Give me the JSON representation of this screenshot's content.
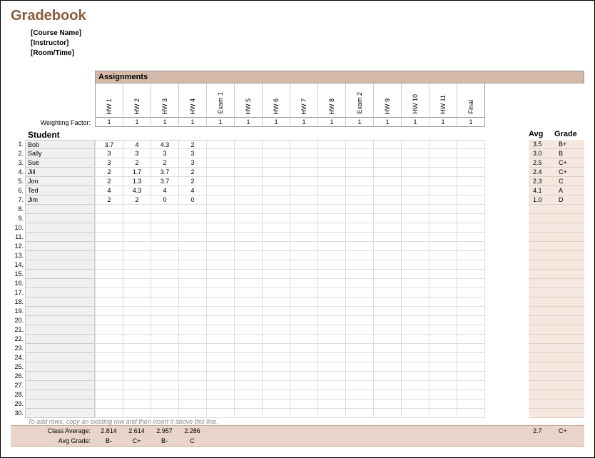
{
  "title": "Gradebook",
  "meta": {
    "course": "[Course Name]",
    "instructor": "[Instructor]",
    "room": "[Room/Time]"
  },
  "assignments_label": "Assignments",
  "assignments": [
    "HW 1",
    "HW 2",
    "HW 3",
    "HW 4",
    "Exam 1",
    "HW 5",
    "HW 6",
    "HW 7",
    "HW 8",
    "Exam 2",
    "HW 9",
    "HW 10",
    "HW 11",
    "Final"
  ],
  "weighting_label": "Weighting Factor:",
  "weights": [
    "1",
    "1",
    "1",
    "1",
    "1",
    "1",
    "1",
    "1",
    "1",
    "1",
    "1",
    "1",
    "1",
    "1"
  ],
  "student_header": "Student",
  "avg_header": "Avg",
  "grade_header": "Grade",
  "students": [
    {
      "num": "1.",
      "name": "Bob",
      "scores": [
        "3.7",
        "4",
        "4.3",
        "2",
        "",
        "",
        "",
        "",
        "",
        "",
        "",
        "",
        "",
        ""
      ],
      "avg": "3.5",
      "grade": "B+"
    },
    {
      "num": "2.",
      "name": "Sally",
      "scores": [
        "3",
        "3",
        "3",
        "3",
        "",
        "",
        "",
        "",
        "",
        "",
        "",
        "",
        "",
        ""
      ],
      "avg": "3.0",
      "grade": "B"
    },
    {
      "num": "3.",
      "name": "Sue",
      "scores": [
        "3",
        "2",
        "2",
        "3",
        "",
        "",
        "",
        "",
        "",
        "",
        "",
        "",
        "",
        ""
      ],
      "avg": "2.5",
      "grade": "C+"
    },
    {
      "num": "4.",
      "name": "Jill",
      "scores": [
        "2",
        "1.7",
        "3.7",
        "2",
        "",
        "",
        "",
        "",
        "",
        "",
        "",
        "",
        "",
        ""
      ],
      "avg": "2.4",
      "grade": "C+"
    },
    {
      "num": "5.",
      "name": "Jon",
      "scores": [
        "2",
        "1.3",
        "3.7",
        "2",
        "",
        "",
        "",
        "",
        "",
        "",
        "",
        "",
        "",
        ""
      ],
      "avg": "2.3",
      "grade": "C"
    },
    {
      "num": "6.",
      "name": "Ted",
      "scores": [
        "4",
        "4.3",
        "4",
        "4",
        "",
        "",
        "",
        "",
        "",
        "",
        "",
        "",
        "",
        ""
      ],
      "avg": "4.1",
      "grade": "A"
    },
    {
      "num": "7.",
      "name": "Jim",
      "scores": [
        "2",
        "2",
        "0",
        "0",
        "",
        "",
        "",
        "",
        "",
        "",
        "",
        "",
        "",
        ""
      ],
      "avg": "1.0",
      "grade": "D"
    },
    {
      "num": "8.",
      "name": "",
      "scores": [
        "",
        "",
        "",
        "",
        "",
        "",
        "",
        "",
        "",
        "",
        "",
        "",
        "",
        ""
      ],
      "avg": "",
      "grade": ""
    },
    {
      "num": "9.",
      "name": "",
      "scores": [
        "",
        "",
        "",
        "",
        "",
        "",
        "",
        "",
        "",
        "",
        "",
        "",
        "",
        ""
      ],
      "avg": "",
      "grade": ""
    },
    {
      "num": "10.",
      "name": "",
      "scores": [
        "",
        "",
        "",
        "",
        "",
        "",
        "",
        "",
        "",
        "",
        "",
        "",
        "",
        ""
      ],
      "avg": "",
      "grade": ""
    },
    {
      "num": "11.",
      "name": "",
      "scores": [
        "",
        "",
        "",
        "",
        "",
        "",
        "",
        "",
        "",
        "",
        "",
        "",
        "",
        ""
      ],
      "avg": "",
      "grade": ""
    },
    {
      "num": "12.",
      "name": "",
      "scores": [
        "",
        "",
        "",
        "",
        "",
        "",
        "",
        "",
        "",
        "",
        "",
        "",
        "",
        ""
      ],
      "avg": "",
      "grade": ""
    },
    {
      "num": "13.",
      "name": "",
      "scores": [
        "",
        "",
        "",
        "",
        "",
        "",
        "",
        "",
        "",
        "",
        "",
        "",
        "",
        ""
      ],
      "avg": "",
      "grade": ""
    },
    {
      "num": "14.",
      "name": "",
      "scores": [
        "",
        "",
        "",
        "",
        "",
        "",
        "",
        "",
        "",
        "",
        "",
        "",
        "",
        ""
      ],
      "avg": "",
      "grade": ""
    },
    {
      "num": "15.",
      "name": "",
      "scores": [
        "",
        "",
        "",
        "",
        "",
        "",
        "",
        "",
        "",
        "",
        "",
        "",
        "",
        ""
      ],
      "avg": "",
      "grade": ""
    },
    {
      "num": "16.",
      "name": "",
      "scores": [
        "",
        "",
        "",
        "",
        "",
        "",
        "",
        "",
        "",
        "",
        "",
        "",
        "",
        ""
      ],
      "avg": "",
      "grade": ""
    },
    {
      "num": "17.",
      "name": "",
      "scores": [
        "",
        "",
        "",
        "",
        "",
        "",
        "",
        "",
        "",
        "",
        "",
        "",
        "",
        ""
      ],
      "avg": "",
      "grade": ""
    },
    {
      "num": "18.",
      "name": "",
      "scores": [
        "",
        "",
        "",
        "",
        "",
        "",
        "",
        "",
        "",
        "",
        "",
        "",
        "",
        ""
      ],
      "avg": "",
      "grade": ""
    },
    {
      "num": "19.",
      "name": "",
      "scores": [
        "",
        "",
        "",
        "",
        "",
        "",
        "",
        "",
        "",
        "",
        "",
        "",
        "",
        ""
      ],
      "avg": "",
      "grade": ""
    },
    {
      "num": "20.",
      "name": "",
      "scores": [
        "",
        "",
        "",
        "",
        "",
        "",
        "",
        "",
        "",
        "",
        "",
        "",
        "",
        ""
      ],
      "avg": "",
      "grade": ""
    },
    {
      "num": "21.",
      "name": "",
      "scores": [
        "",
        "",
        "",
        "",
        "",
        "",
        "",
        "",
        "",
        "",
        "",
        "",
        "",
        ""
      ],
      "avg": "",
      "grade": ""
    },
    {
      "num": "22.",
      "name": "",
      "scores": [
        "",
        "",
        "",
        "",
        "",
        "",
        "",
        "",
        "",
        "",
        "",
        "",
        "",
        ""
      ],
      "avg": "",
      "grade": ""
    },
    {
      "num": "23.",
      "name": "",
      "scores": [
        "",
        "",
        "",
        "",
        "",
        "",
        "",
        "",
        "",
        "",
        "",
        "",
        "",
        ""
      ],
      "avg": "",
      "grade": ""
    },
    {
      "num": "24.",
      "name": "",
      "scores": [
        "",
        "",
        "",
        "",
        "",
        "",
        "",
        "",
        "",
        "",
        "",
        "",
        "",
        ""
      ],
      "avg": "",
      "grade": ""
    },
    {
      "num": "25.",
      "name": "",
      "scores": [
        "",
        "",
        "",
        "",
        "",
        "",
        "",
        "",
        "",
        "",
        "",
        "",
        "",
        ""
      ],
      "avg": "",
      "grade": ""
    },
    {
      "num": "26.",
      "name": "",
      "scores": [
        "",
        "",
        "",
        "",
        "",
        "",
        "",
        "",
        "",
        "",
        "",
        "",
        "",
        ""
      ],
      "avg": "",
      "grade": ""
    },
    {
      "num": "27.",
      "name": "",
      "scores": [
        "",
        "",
        "",
        "",
        "",
        "",
        "",
        "",
        "",
        "",
        "",
        "",
        "",
        ""
      ],
      "avg": "",
      "grade": ""
    },
    {
      "num": "28.",
      "name": "",
      "scores": [
        "",
        "",
        "",
        "",
        "",
        "",
        "",
        "",
        "",
        "",
        "",
        "",
        "",
        ""
      ],
      "avg": "",
      "grade": ""
    },
    {
      "num": "29.",
      "name": "",
      "scores": [
        "",
        "",
        "",
        "",
        "",
        "",
        "",
        "",
        "",
        "",
        "",
        "",
        "",
        ""
      ],
      "avg": "",
      "grade": ""
    },
    {
      "num": "30.",
      "name": "",
      "scores": [
        "",
        "",
        "",
        "",
        "",
        "",
        "",
        "",
        "",
        "",
        "",
        "",
        "",
        ""
      ],
      "avg": "",
      "grade": ""
    }
  ],
  "footnote": "To add rows, copy an existing row and then insert it above this line.",
  "class_avg_label": "Class Average:",
  "avg_grade_label": "Avg Grade:",
  "class_avgs": [
    "2.814",
    "2.614",
    "2.957",
    "2.286",
    "",
    "",
    "",
    "",
    "",
    "",
    "",
    "",
    "",
    ""
  ],
  "avg_grades": [
    "B-",
    "C+",
    "B-",
    "C",
    "",
    "",
    "",
    "",
    "",
    "",
    "",
    "",
    "",
    ""
  ],
  "overall_avg": "2.7",
  "overall_grade": "C+"
}
